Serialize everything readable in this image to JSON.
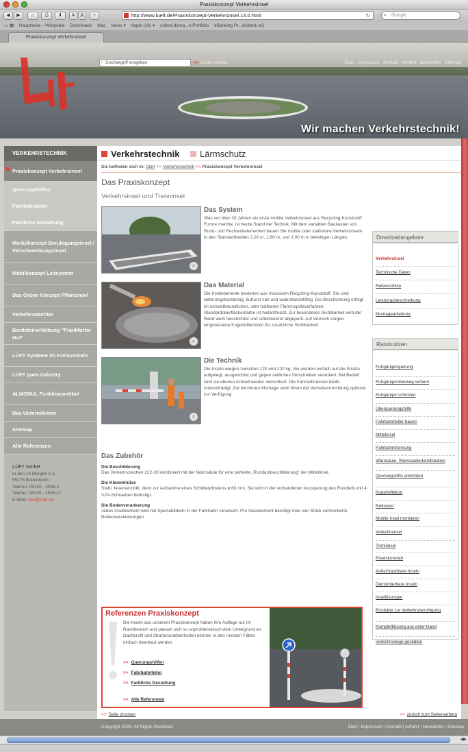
{
  "browser": {
    "window_title": "Praxiskonzept Verkehrsinsel",
    "url": "http://www.lueft.de/Praxiskonzept-Verkehrsinsel.14.0.html",
    "search_placeholder": "Google",
    "nav_buttons": [
      "◀",
      "▶",
      "⌂",
      "⎙",
      "⬇",
      "A",
      "A",
      "+"
    ],
    "bookmarks": [
      "Hauptseite – Wikipedia",
      "Downloads",
      "Mac",
      "News ▾",
      "Apple (16) ▾",
      "united-doma...n-Portfolio",
      "eBanking Pr...oikbank eG"
    ],
    "tab_label": "Praxiskonzept Verkehrsinsel"
  },
  "header": {
    "search_placeholder": "Suchbegriff eingeben",
    "search_button": "Suche starten",
    "topnav": [
      "Start",
      "Impressum",
      "Kontakt",
      "Anfahrt",
      "Newsletter",
      "Sitemap"
    ],
    "claim": "Wir machen Verkehrstechnik!",
    "logo_text": "Lüft"
  },
  "sidebar": {
    "heading": "VERKEHRSTECHNIK",
    "items": [
      {
        "label": "Praxiskonzept Verkehrsinsel"
      },
      {
        "label": "Querungshilfen"
      },
      {
        "label": "Fahrbahnteiler"
      },
      {
        "label": "Farbliche Gestaltung"
      },
      {
        "label": "Modulkonzept Beruhigungsinsel / Verschwenkungsinsel"
      },
      {
        "label": "Mobilkonzept Leitsystem"
      },
      {
        "label": "Das Grüne Konzept Pflanzinsel"
      },
      {
        "label": "Verkehrswächter"
      },
      {
        "label": "Bordsteinerhöhung \"Frankfurter Hut\""
      },
      {
        "label": "LÜFT Systeme im Kreisverkehr"
      },
      {
        "label": "LÜFT goes industry"
      },
      {
        "label": "ALMODUL Funktionsmöbel"
      },
      {
        "label": "Das Unternehmen"
      },
      {
        "label": "Sitemap"
      },
      {
        "label": "Alle Referenzen"
      }
    ],
    "company": {
      "name": "LÜFT GmbH",
      "street": "In den 14 Morgen 1-5",
      "city": "55275 Budenheim",
      "phone": "Telefon: 06139 - 2936-0",
      "fax": "Telefax: 06139 - 2936-11",
      "email_label": "E-Mail:",
      "email": "info@lueft.de"
    }
  },
  "tabs": {
    "active": "Verkehrstechnik",
    "inactive": "Lärmschutz"
  },
  "breadcrumb": {
    "prefix": "Sie befinden sich in:",
    "items": [
      "Start",
      "Verkehrstechnik",
      "Praxiskonzept Verkehrsinsel"
    ]
  },
  "content": {
    "title": "Das Praxiskonzept",
    "subtitle": "Verkehrsinsel und Trenninsel",
    "features": [
      {
        "title": "Das System",
        "text": "Was vor über 20 Jahren als erste mobile Verkehrsinsel aus Recycling-Kunststoff Furore machte, ist heute Stand der Technik. Mit dem variablen Baukasten von Rund- und Rechteckelementen bauen Sie mobile oder stationäre Verkehrsinseln in den Standardbreiten 2,00 m, 1,60 m, und 1,00 m in beliebigen Längen."
      },
      {
        "title": "Das Material",
        "text": "Die Inselelemente bestehen aus massivem Recycling-Kunststoff. Sie sind witterungsbeständig, äußerst zäh und widerstandsfähig. Die Beschichtung erfolgt im umweltfreundlichen, sehr haltbaren Flammspritzverfahren. Standardoberflächenfarbe ist hellanthrazit. Zur besonderen Sichtbarkeit wird der Rand weiß beschichtet und reflektierend abgeperlt. Auf Wunsch sorgen eingelassene Kugelreflektoren für zusätzliche Sichtbarkeit."
      },
      {
        "title": "Die Technik",
        "text": "Die Inseln wiegen zwischen 120 und 220 kg. Sie werden einfach auf die Straße aufgelegt, ausgerichtet und gegen seitliches Verschieben verankert. Bei Bedarf sind sie ebenso schnell wieder demontiert. Die Fahrbahndecke bleibt unbeschädigt. Zur leichteren Montage steht Ihnen die Verhebevorrichtung optional zur Verfügung."
      }
    ],
    "zubehoer": {
      "title": "Das Zubehör",
      "items": [
        {
          "title": "Die Beschilderung",
          "text": "Das Verkehrszeichen 222-20 kombiniert mit der Warnsäule für eine perfekte „Rundumbeschilderung\" der Mittelinsel."
        },
        {
          "title": "Die Klemmhülse",
          "text": "Stahl, feuerverzinkt, dient zur Aufnahme eines Schilderpfostens ø 60 mm. Sie wird in der vorhandenen Aussparung des Rundteils mit 4 V2A-Schrauben befestigt."
        },
        {
          "title": "Die Bodenverankerung",
          "text": "Jedes Inselelement wird mit Spezialdübeln in der Fahrbahn verankert. Pro Inselelement benötigt man vier Stück vormontierte Bodenverankerungen."
        }
      ]
    }
  },
  "references": {
    "title": "Referenzen Praxiskonzept",
    "text": "Die Inseln aus unserem Praxiskonzept haben ihre Auflage nur im Randbereich und passen sich so unproblematisch dem Untergrund an. Dachprofil und Straßenunebenheiten können in den meisten Fällen einfach überbaut werden.",
    "links": [
      "Querungshilfen",
      "Fahrbahnteiler",
      "Farbliche Gestaltung"
    ],
    "all_link": "Alle Referenzen",
    "arrow": ">>"
  },
  "downloads": {
    "title": "Downloadangebote",
    "items": [
      "Verkehrsinsel",
      "Technische Daten",
      "Referenzliste",
      "Leistungsbeschreibung",
      "Montageanleitung"
    ]
  },
  "randnotizen": {
    "title": "Randnotizen",
    "items": [
      "Fußgängerquerung",
      "Fußgängerüberweg sichern",
      "Fußgänger schützen",
      "Überquerungshilfe",
      "Fahrbahnteiler bauen",
      "Mittelinsel",
      "Fahrbahntrennung",
      "Warnsäule, Warnsäulenkombination",
      "Querungshilfe einrichten",
      "Kugelreflektor",
      "Reflexion",
      "Mobile Insel montieren",
      "Verkehrsinsel",
      "Trenninsel",
      "Praxiskonzept",
      "Aufschraubbare Inseln",
      "Demontierbare Inseln",
      "Insellösungen",
      "Produkte zur Verkehrsberuhigung",
      "Komplettlösung aus einer Hand",
      "Verkehrswege gestalten"
    ]
  },
  "footer": {
    "print": "Seite drucken",
    "top": "zurück zum Seitenanfang",
    "copyright": "Copyright 2009, All Rights Reserved",
    "nav": [
      "Start",
      "Impressum",
      "Kontakt",
      "Anfahrt",
      "Newsletter",
      "Sitemap"
    ]
  },
  "colors": {
    "accent_red": "#dd4433",
    "sidebar": "#b9b8b3",
    "footer": "#898985"
  }
}
